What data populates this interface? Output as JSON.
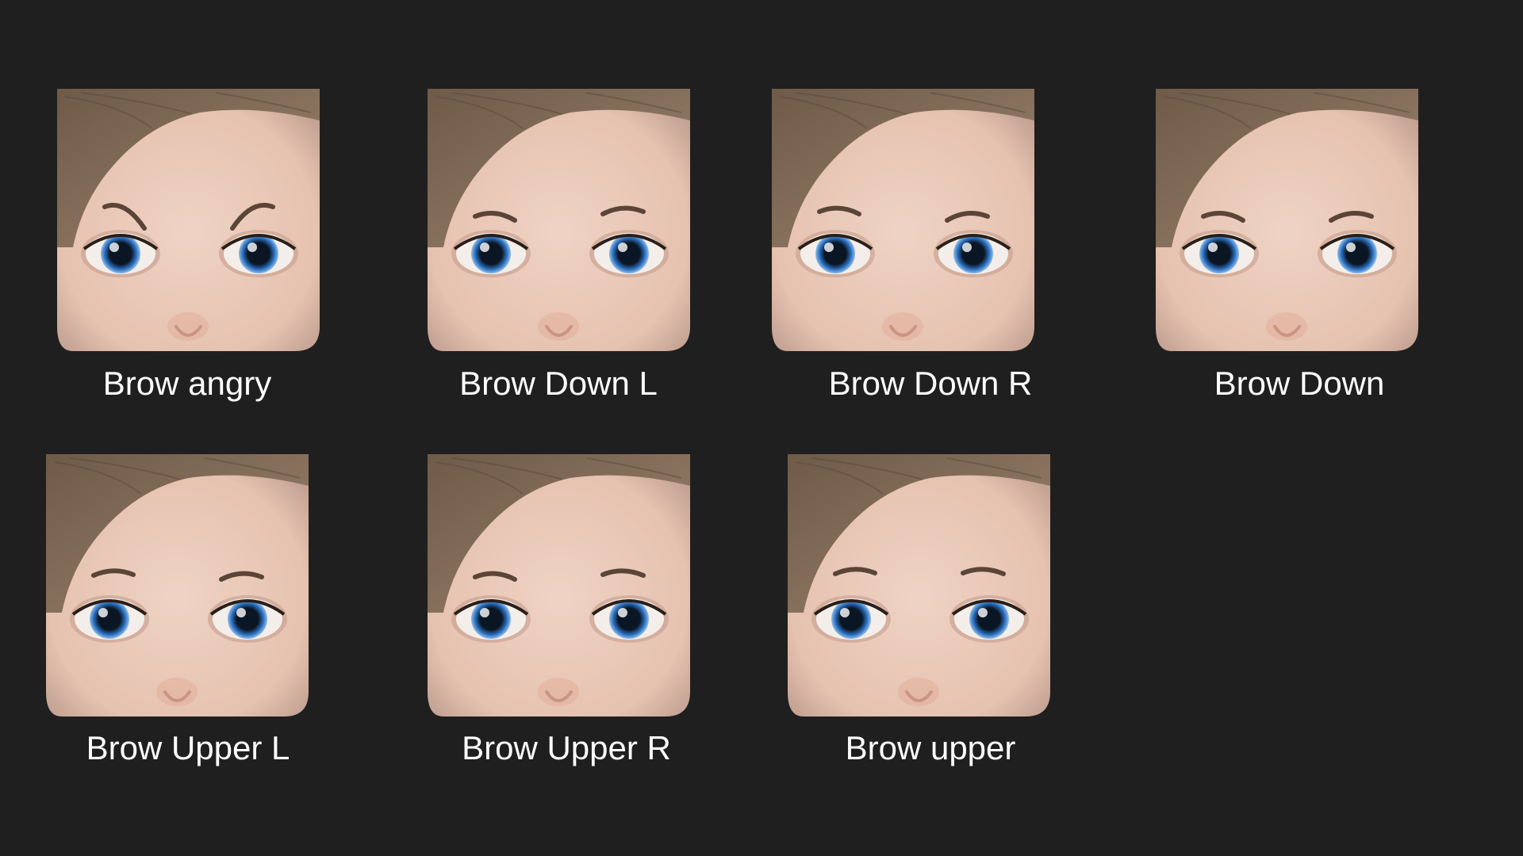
{
  "gallery": {
    "items": [
      {
        "label": "Brow angry",
        "expression": "angry"
      },
      {
        "label": "Brow Down L",
        "expression": "down-left"
      },
      {
        "label": "Brow Down R",
        "expression": "down-right"
      },
      {
        "label": "Brow Down",
        "expression": "down"
      },
      {
        "label": "Brow Upper L",
        "expression": "upper-left"
      },
      {
        "label": "Brow Upper R",
        "expression": "upper-right"
      },
      {
        "label": "Brow upper",
        "expression": "upper"
      }
    ]
  },
  "colors": {
    "background": "#1f1f1f",
    "skin": "#e6c2b0",
    "hair": "#8a7460",
    "iris": "#2a6fc0",
    "caption": "#ffffff"
  }
}
